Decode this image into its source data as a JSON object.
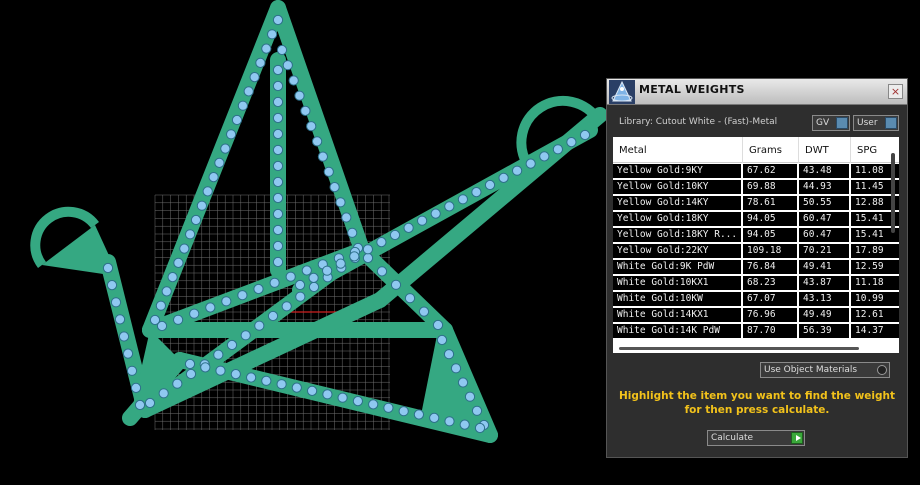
{
  "panel": {
    "title": "METAL WEIGHTS",
    "library_label": "Library: Cutout White - (Fast)-Metal",
    "gv_label": "GV",
    "user_label": "User",
    "close_label": "×",
    "use_object_materials_label": "Use Object Materials",
    "instructions": "Highlight the item you want to find the weight for then press calculate.",
    "calculate_label": "Calculate"
  },
  "table": {
    "headers": {
      "metal": "Metal",
      "grams": "Grams",
      "dwt": "DWT",
      "spg": "SPG"
    },
    "rows": [
      {
        "metal": "Yellow Gold:9KY",
        "grams": "67.62",
        "dwt": "43.48",
        "spg": "11.08"
      },
      {
        "metal": "Yellow Gold:10KY",
        "grams": "69.88",
        "dwt": "44.93",
        "spg": "11.45"
      },
      {
        "metal": "Yellow Gold:14KY",
        "grams": "78.61",
        "dwt": "50.55",
        "spg": "12.88"
      },
      {
        "metal": "Yellow Gold:18KY",
        "grams": "94.05",
        "dwt": "60.47",
        "spg": "15.41"
      },
      {
        "metal": "Yellow Gold:18KY R...",
        "grams": "94.05",
        "dwt": "60.47",
        "spg": "15.41"
      },
      {
        "metal": "Yellow Gold:22KY",
        "grams": "109.18",
        "dwt": "70.21",
        "spg": "17.89"
      },
      {
        "metal": "White Gold:9K PdW",
        "grams": "76.84",
        "dwt": "49.41",
        "spg": "12.59"
      },
      {
        "metal": "White Gold:10KX1",
        "grams": "68.23",
        "dwt": "43.87",
        "spg": "11.18"
      },
      {
        "metal": "White Gold:10KW",
        "grams": "67.07",
        "dwt": "43.13",
        "spg": "10.99"
      },
      {
        "metal": "White Gold:14KX1",
        "grams": "76.96",
        "dwt": "49.49",
        "spg": "12.61"
      },
      {
        "metal": "White Gold:14K PdW",
        "grams": "87.70",
        "dwt": "56.39",
        "spg": "14.37"
      }
    ]
  },
  "colors": {
    "model_fill": "#35a882",
    "gem_fill": "#8fc8f0",
    "gem_stroke": "#2d6f8a",
    "grid": "#6f6f6f",
    "instruction_text": "#f2c21b",
    "red_axis": "#d02020"
  },
  "icons": {
    "app": "metal-weights-app-icon",
    "close": "close-icon",
    "calculate": "play-arrow-icon"
  }
}
